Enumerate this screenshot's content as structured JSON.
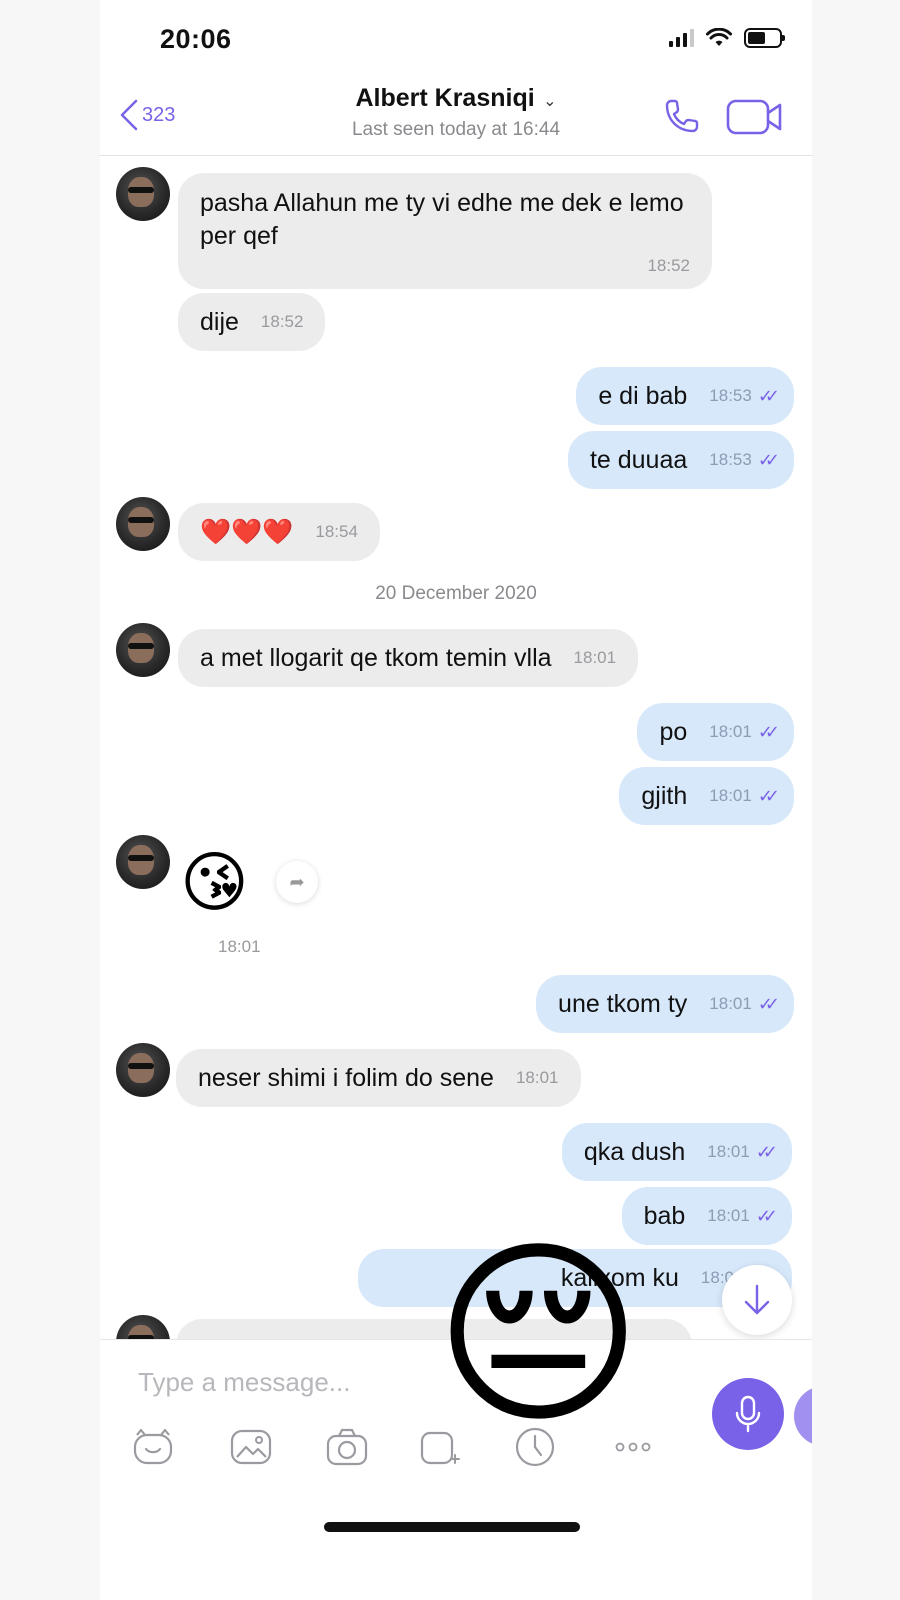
{
  "status_bar": {
    "time": "20:06"
  },
  "header": {
    "back_count": "323",
    "contact_name": "Albert Krasniqi",
    "last_seen": "Last seen today at 16:44"
  },
  "messages": [
    {
      "dir": "in",
      "text": "pasha Allahun me ty vi edhe me dek e lemo per qef",
      "time": "18:52"
    },
    {
      "dir": "in",
      "text": "dije",
      "time": "18:52"
    },
    {
      "dir": "out",
      "text": "e di bab",
      "time": "18:53"
    },
    {
      "dir": "out",
      "text": "te duuaa",
      "time": "18:53"
    },
    {
      "dir": "in",
      "text": "❤️❤️❤️",
      "time": "18:54"
    },
    {
      "dir": "in",
      "text": "a met llogarit qe tkom temin vlla",
      "time": "18:01"
    },
    {
      "dir": "out",
      "text": "po",
      "time": "18:01"
    },
    {
      "dir": "out",
      "text": "gjith",
      "time": "18:01"
    },
    {
      "dir": "in",
      "text": "😘",
      "time": "18:01"
    },
    {
      "dir": "out",
      "text": "une tkom ty",
      "time": "18:01"
    },
    {
      "dir": "in",
      "text": "neser shimi i folim do sene",
      "time": "18:01"
    },
    {
      "dir": "out",
      "text": "qka dush",
      "time": "18:01"
    },
    {
      "dir": "out",
      "text": "bab",
      "time": "18:01"
    },
    {
      "dir": "out",
      "text": "kallxom ku",
      "time": "18:0"
    }
  ],
  "date_separator": "20 December 2020",
  "read_ticks": "✓✓",
  "composer": {
    "placeholder": "Type a message..."
  },
  "overlay_emoji": "😔",
  "colors": {
    "accent": "#7a62e8",
    "incoming_bubble": "#ececed",
    "outgoing_bubble": "#d7e8fb"
  },
  "icons": [
    "back-chevron-icon",
    "phone-icon",
    "video-icon",
    "sticker-icon",
    "gallery-icon",
    "camera-icon",
    "gif-icon",
    "clock-icon",
    "more-icon",
    "mic-icon",
    "share-icon",
    "arrow-down-icon"
  ]
}
